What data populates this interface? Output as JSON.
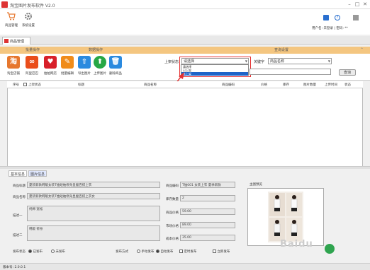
{
  "window": {
    "title": "淘宝图片发布软件 V2.0",
    "min": "–",
    "max": "□",
    "close": "✕"
  },
  "toolbar": {
    "items": [
      {
        "label": "商品管理",
        "icon": "cart-icon"
      },
      {
        "label": "系统设置",
        "icon": "gear-icon"
      }
    ]
  },
  "right_panel": {
    "icons": [
      "save-icon",
      "help-icon",
      "minimize-icon"
    ],
    "user_text": "用户名: 未登录 | 密码: **"
  },
  "tabs": {
    "active": "商品管理"
  },
  "sections": {
    "left": "批量操作",
    "middle": "数据操作",
    "right": "查询设置"
  },
  "actions": [
    {
      "label": "淘宝",
      "letter": "淘",
      "color": "#e6772e",
      "caption": "淘宝店铺"
    },
    {
      "label": "阿里巴巴",
      "letter": "∞",
      "color": "#ea4e1b",
      "caption": "阿里巴巴"
    },
    {
      "label": "拍拍",
      "letter": "♥",
      "color": "#d8202a",
      "caption": "拍拍网店"
    },
    {
      "label": "编辑",
      "letter": "✎",
      "color": "#f08c1a",
      "caption": "批量编辑"
    },
    {
      "label": "导出",
      "letter": "⇧",
      "color": "#2a8adf",
      "caption": "导出图片"
    },
    {
      "label": "上传",
      "letter": "⬆",
      "color": "#27a745",
      "caption": "上传图片"
    },
    {
      "label": "删除",
      "letter": "🗑",
      "color": "#2a8adf",
      "caption": "删除商品"
    }
  ],
  "filters": {
    "type_label": "上架状态",
    "type_value": "请选择",
    "dropdown_options": [
      "请选择",
      "已上架",
      "未上架"
    ],
    "keyword_label": "关键字",
    "keyword_value": "商品名称",
    "search_button": "查询"
  },
  "list": {
    "columns": [
      "序号",
      "上架状态",
      "标题",
      "商品名称",
      "商品编码",
      "价格",
      "库存",
      "图片数量",
      "上传时间",
      "是否发布",
      "状态"
    ]
  },
  "detail": {
    "tabs": [
      "基本信息",
      "图片信息"
    ],
    "fields": {
      "title_label": "商品标题",
      "title_value": "夏装新款韩版女装T恤短袖修身显瘦百搭上衣",
      "name_label": "商品名称",
      "name_value": "夏装新款韩版女装T恤短袖修身显瘦百搭上衣女",
      "desc1_label": "描述一",
      "desc1_value": "纯棉 宽松",
      "desc2_label": "描述二",
      "desc2_value": "韩版 修身",
      "seller_label": "商品编码",
      "seller_value": "T恤001 女装上衣 夏季新款",
      "stock_label": "库存数量",
      "stock_value": "2",
      "price1_label": "商品价格",
      "price1_value": "59.00",
      "price2_label": "市场价格",
      "price2_value": "89.00",
      "price3_label": "成本价格",
      "price3_value": "35.00",
      "image_label": "主图预览",
      "status_label": "发布状态",
      "status_on": "已发布",
      "status_off": "未发布",
      "mode_label": "发布方式",
      "mode_opt1": "手动发布",
      "mode_opt2": "自动发布",
      "check_opt1": "定时发布",
      "check_opt2": "立即发布"
    }
  },
  "status_bar": {
    "text": "版本号: 2.0.0.1"
  }
}
